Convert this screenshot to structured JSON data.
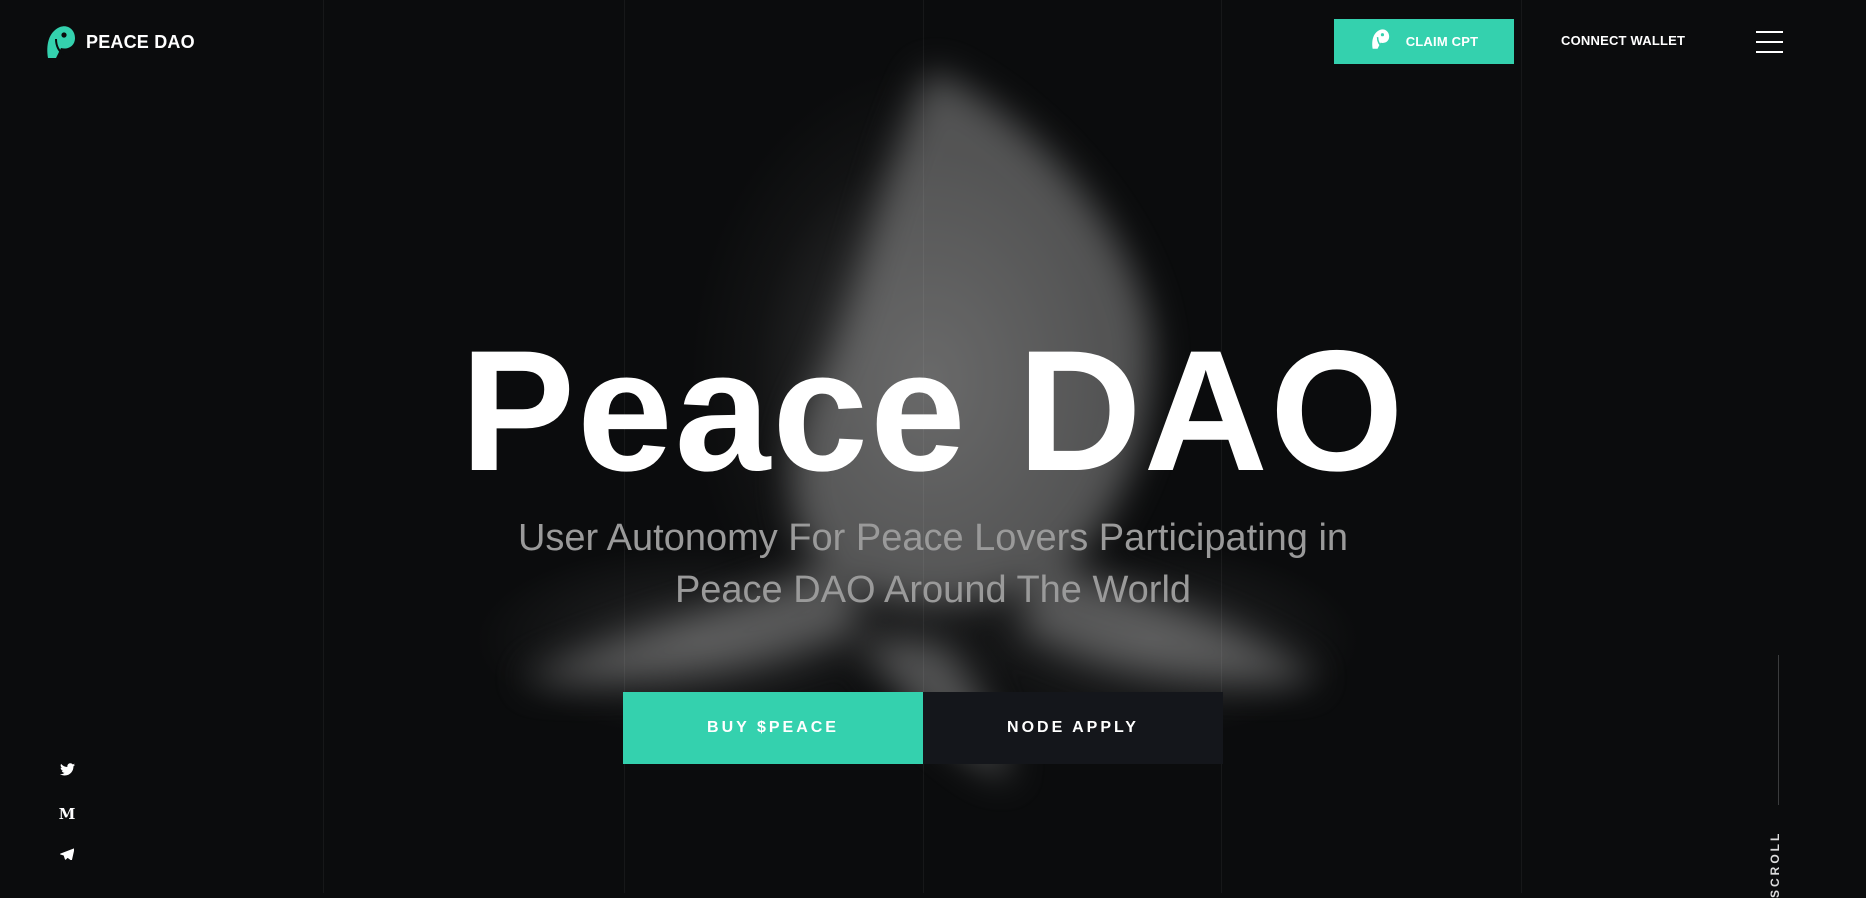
{
  "brand": {
    "name": "PEACE DAO",
    "accent_color": "#34d1ae",
    "logo_icon": "dove-head-icon"
  },
  "header": {
    "claim_label": "CLAIM CPT",
    "claim_icon": "dove-head-icon",
    "connect_label": "CONNECT WALLET",
    "menu_icon": "hamburger-menu-icon"
  },
  "hero": {
    "title": "Peace DAO",
    "subtitle_line1": "User Autonomy For Peace Lovers Participating in",
    "subtitle_line2": "Peace DAO Around The World",
    "buy_label": "BUY $PEACE",
    "node_label": "NODE APPLY",
    "background_image": "dove-photo"
  },
  "social": {
    "icons": [
      "twitter-icon",
      "medium-icon",
      "telegram-icon"
    ],
    "medium_glyph": "M"
  },
  "scroll": {
    "label": "SCROLL"
  }
}
